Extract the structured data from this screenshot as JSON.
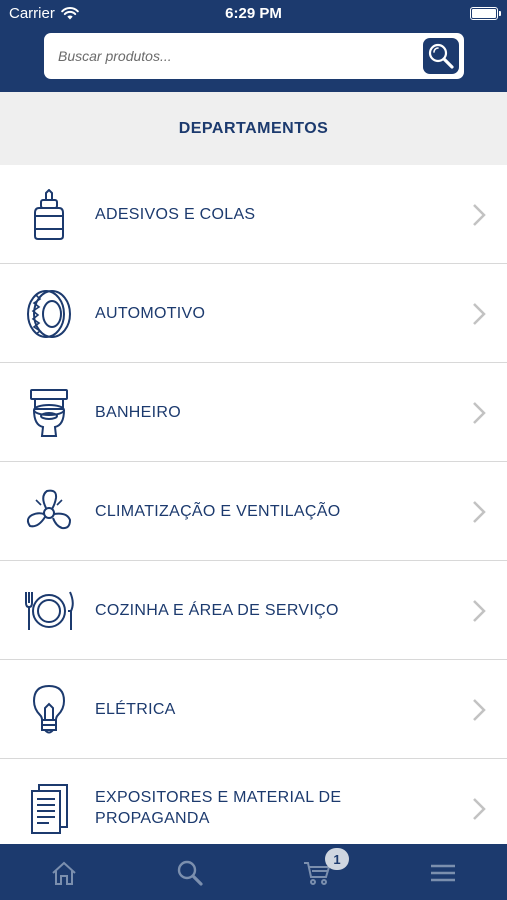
{
  "status_bar": {
    "carrier": "Carrier",
    "time": "6:29 PM"
  },
  "search": {
    "placeholder": "Buscar produtos..."
  },
  "section": {
    "title": "DEPARTAMENTOS"
  },
  "departments": [
    {
      "label": "ADESIVOS E COLAS",
      "icon": "glue-bottle-icon"
    },
    {
      "label": "AUTOMOTIVO",
      "icon": "tire-icon"
    },
    {
      "label": "BANHEIRO",
      "icon": "toilet-icon"
    },
    {
      "label": "CLIMATIZAÇÃO E VENTILAÇÃO",
      "icon": "fan-icon"
    },
    {
      "label": "COZINHA E ÁREA DE SERVIÇO",
      "icon": "plate-cutlery-icon"
    },
    {
      "label": "ELÉTRICA",
      "icon": "lightbulb-icon"
    },
    {
      "label": "EXPOSITORES E MATERIAL DE PROPAGANDA",
      "icon": "document-icon"
    }
  ],
  "tab_bar": {
    "tabs": [
      "home-icon",
      "search-icon",
      "cart-icon",
      "menu-icon"
    ],
    "cart_badge": "1"
  },
  "colors": {
    "primary": "#1c3a6e",
    "section_bg": "#efefef",
    "tab_inactive": "#7b8fae"
  }
}
